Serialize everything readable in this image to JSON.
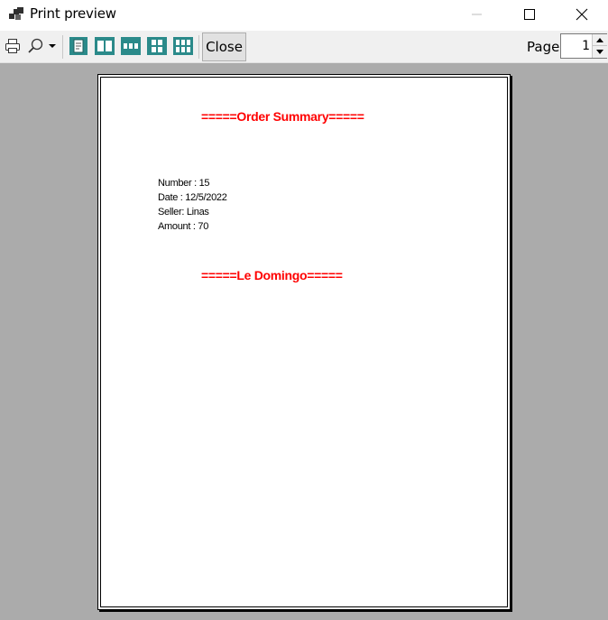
{
  "window": {
    "title": "Print preview",
    "icon": "print-preview-app-icon",
    "controls": [
      "minimize",
      "maximize",
      "close"
    ]
  },
  "toolbar": {
    "buttons": [
      {
        "name": "print",
        "icon": "printer-icon"
      },
      {
        "name": "zoom",
        "icon": "magnifier-icon",
        "has_dropdown": true
      },
      {
        "name": "one-page",
        "icon": "one-page-icon"
      },
      {
        "name": "two-pages",
        "icon": "two-pages-icon"
      },
      {
        "name": "three-pages",
        "icon": "three-pages-icon"
      },
      {
        "name": "four-pages",
        "icon": "four-pages-icon"
      },
      {
        "name": "six-pages",
        "icon": "six-pages-icon"
      }
    ],
    "close_label": "Close",
    "page_label": "Page",
    "page_value": "1"
  },
  "document": {
    "heading": "=====Order Summary=====",
    "lines": [
      "Number : 15",
      "Date : 12/5/2022",
      "Seller: Linas",
      "Amount : 70"
    ],
    "footer": "=====Le Domingo====="
  },
  "colors": {
    "heading": "#ff0000",
    "background": "#ababab",
    "toolbar": "#f0f0f0",
    "icon_accent": "#2b8a8a"
  }
}
